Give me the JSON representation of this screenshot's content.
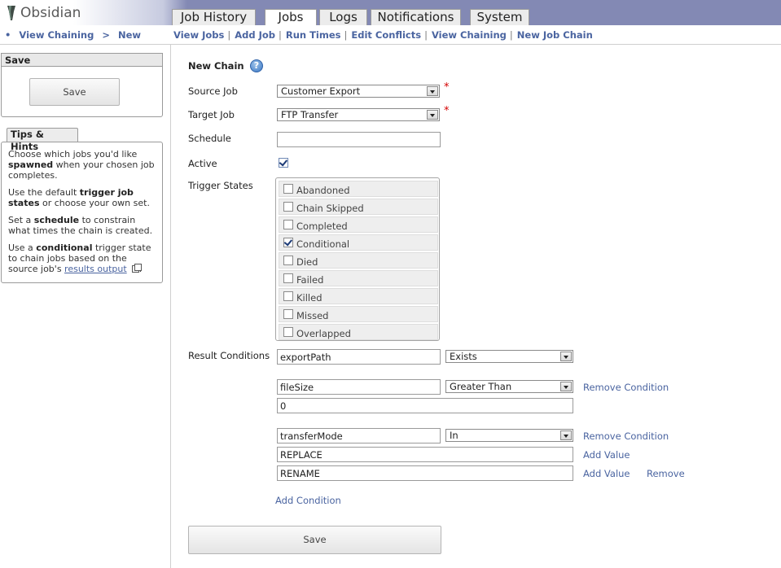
{
  "app": {
    "name": "Obsidian"
  },
  "tabs": [
    "Job History",
    "Jobs",
    "Logs",
    "Notifications",
    "System"
  ],
  "breadcrumb": {
    "bullet": "•",
    "parent": "View Chaining",
    "separator": ">",
    "current": "New"
  },
  "subnav": [
    "View Jobs",
    "Add Job",
    "Run Times",
    "Edit Conflicts",
    "View Chaining",
    "New Job Chain"
  ],
  "subnav_sep": "|",
  "sidebar": {
    "save_title": "Save",
    "save_button": "Save",
    "tips_title": "Tips & Hints",
    "tips": {
      "t1a": "Choose which jobs you'd like ",
      "t1b": "spawned",
      "t1c": " when your chosen job completes.",
      "t2a": "Use the default ",
      "t2b": "trigger job states",
      "t2c": " or choose your own set.",
      "t3a": "Set a ",
      "t3b": "schedule",
      "t3c": " to constrain what times the chain is created.",
      "t4a": "Use a ",
      "t4b": "conditional",
      "t4c": " trigger state to chain jobs based on the source job's ",
      "t4link": "results output",
      "t4d": "."
    }
  },
  "form": {
    "title": "New Chain",
    "help_glyph": "?",
    "required_mark": "*",
    "source_job": {
      "label": "Source Job",
      "value": "Customer Export"
    },
    "target_job": {
      "label": "Target Job",
      "value": "FTP Transfer"
    },
    "schedule": {
      "label": "Schedule",
      "value": ""
    },
    "active": {
      "label": "Active",
      "checked": true
    },
    "trigger_states": {
      "label": "Trigger States",
      "items": [
        {
          "label": "Abandoned",
          "checked": false
        },
        {
          "label": "Chain Skipped",
          "checked": false
        },
        {
          "label": "Completed",
          "checked": false
        },
        {
          "label": "Conditional",
          "checked": true
        },
        {
          "label": "Died",
          "checked": false
        },
        {
          "label": "Failed",
          "checked": false
        },
        {
          "label": "Killed",
          "checked": false
        },
        {
          "label": "Missed",
          "checked": false
        },
        {
          "label": "Overlapped",
          "checked": false
        }
      ]
    },
    "result_conditions": {
      "label": "Result Conditions",
      "c1": {
        "variable": "exportPath",
        "operator": "Exists"
      },
      "c2": {
        "variable": "fileSize",
        "operator": "Greater Than",
        "value": "0",
        "remove": "Remove Condition"
      },
      "c3": {
        "variable": "transferMode",
        "operator": "In",
        "values": [
          "REPLACE",
          "RENAME"
        ],
        "remove": "Remove Condition",
        "add_value": "Add Value",
        "remove_value": "Remove"
      },
      "add_condition": "Add Condition"
    },
    "save_button": "Save"
  },
  "colors": {
    "header": "#8389b4",
    "link": "#4a64a0",
    "required": "#d40000"
  }
}
